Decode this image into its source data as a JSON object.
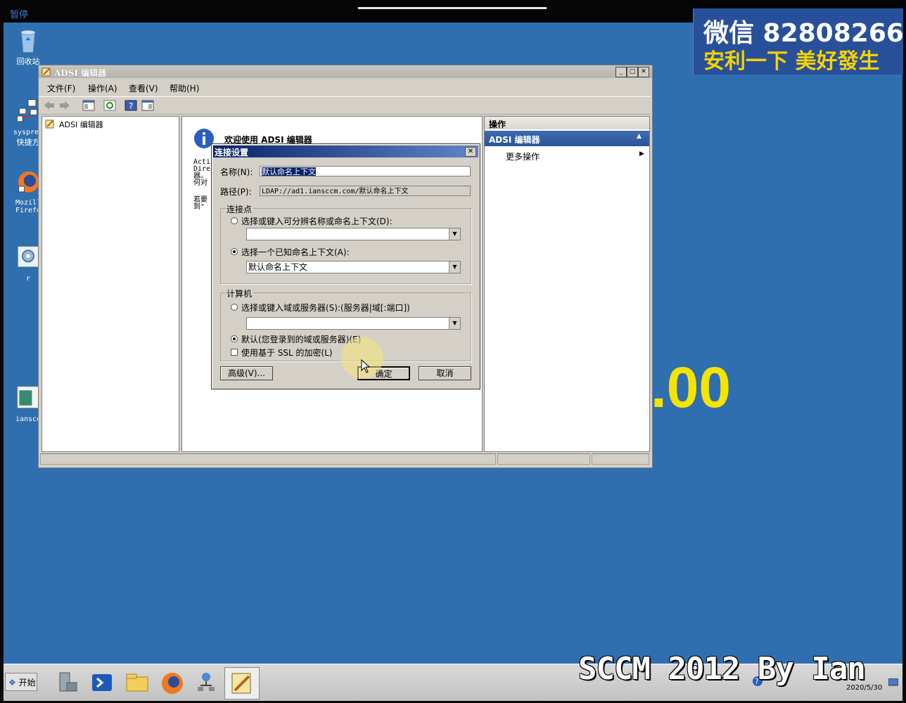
{
  "top_bar": {
    "pause_label": "暂停"
  },
  "watermark": {
    "line1": "微信 82808266",
    "line2": "安利一下 美好發生"
  },
  "background_text": ".00",
  "caption": "SCCM 2012 By Ian",
  "desktop_icons": [
    {
      "label": "回收站",
      "icon": "recycle-bin-icon"
    },
    {
      "label1": "sysprep",
      "label2": "快捷方",
      "icon": "sysprep-shortcut-icon"
    },
    {
      "label1": "Mozill",
      "label2": "Firefo",
      "icon": "firefox-icon"
    },
    {
      "label": "r",
      "icon": "gear-shortcut-icon"
    },
    {
      "label": "iansco",
      "icon": "document-icon"
    }
  ],
  "window": {
    "title": "ADSI 编辑器",
    "menu": [
      "文件(F)",
      "操作(A)",
      "查看(V)",
      "帮助(H)"
    ],
    "tree_root": "ADSI 编辑器",
    "center": {
      "welcome_title": "欢迎使用 ADSI 编辑器",
      "text_lines": [
        "Acti",
        "Dire",
        "器。",
        "何对"
      ],
      "text_lines2": [
        "若要",
        "到\""
      ]
    },
    "actions": {
      "header": "操作",
      "section": "ADSI 编辑器",
      "more": "更多操作"
    }
  },
  "dialog": {
    "title": "连接设置",
    "name_label": "名称(N):",
    "name_value": "默认命名上下文",
    "path_label": "路径(P):",
    "path_value": "LDAP://ad1.iansccm.com/默认命名上下文",
    "connection_point": {
      "legend": "连接点",
      "option1": "选择或键入可分辨名称或命名上下文(D):",
      "option1_value": "",
      "option2": "选择一个已知命名上下文(A):",
      "option2_value": "默认命名上下文",
      "selected": 2
    },
    "computer": {
      "legend": "计算机",
      "option1": "选择或键入域或服务器(S):(服务器|域[:端口])",
      "option1_value": "",
      "option2": "默认(您登录到的域或服务器)(E)",
      "selected": 2,
      "ssl_label": "使用基于 SSL 的加密(L)",
      "ssl_checked": false
    },
    "advanced_button": "高级(V)...",
    "ok_button": "确定",
    "cancel_button": "取消"
  },
  "taskbar": {
    "start": "开始",
    "date": "2020/5/30",
    "apps": [
      "server-manager-icon",
      "powershell-icon",
      "explorer-icon",
      "firefox-icon",
      "network-icon",
      "adsi-edit-icon"
    ]
  }
}
